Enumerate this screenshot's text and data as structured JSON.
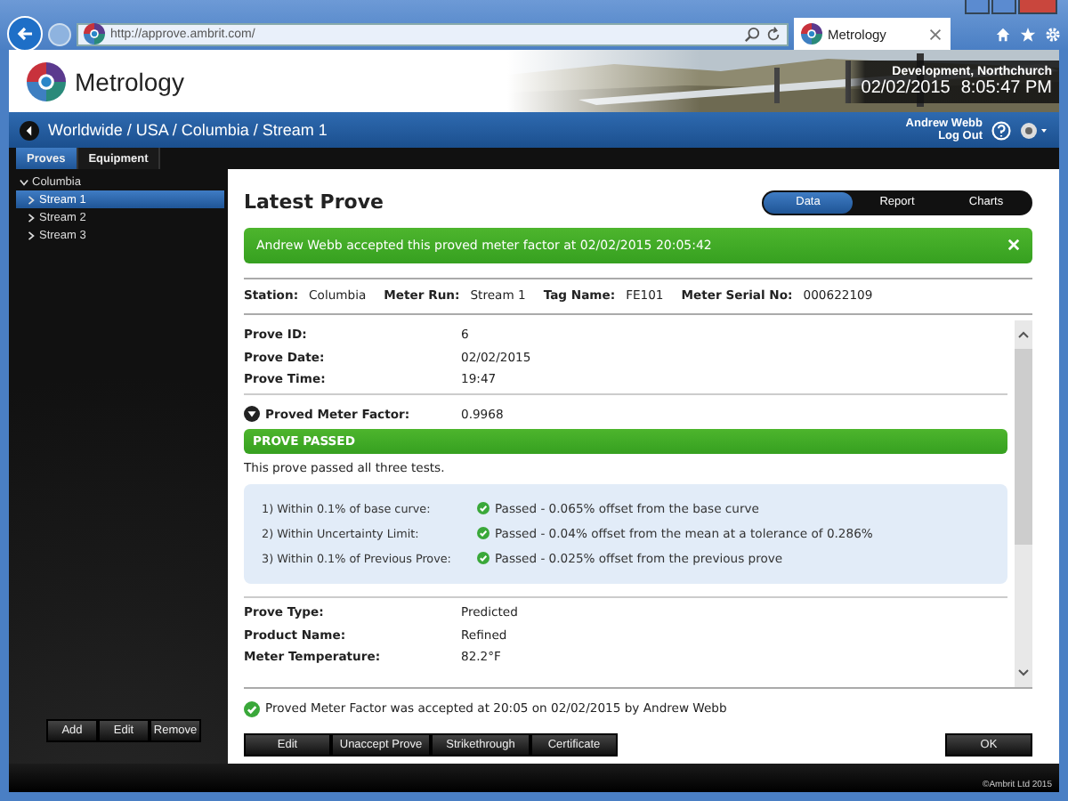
{
  "browser": {
    "address": "http://approve.ambrit.com/",
    "tab_title": "Metrology"
  },
  "header": {
    "app_name": "Metrology",
    "location": "Development, Northchurch",
    "date": "02/02/2015",
    "time": "8:05:47 PM"
  },
  "breadcrumb": "Worldwide / USA / Columbia / Stream 1",
  "user": {
    "name": "Andrew Webb",
    "logout": "Log Out"
  },
  "nav_tabs": [
    {
      "label": "Proves",
      "selected": true
    },
    {
      "label": "Equipment",
      "selected": false
    }
  ],
  "sidebar": {
    "tree": [
      {
        "label": "Columbia",
        "expanded": true,
        "selected": false,
        "children": [
          {
            "label": "Stream 1",
            "selected": true
          },
          {
            "label": "Stream 2",
            "selected": false
          },
          {
            "label": "Stream 3",
            "selected": false
          }
        ]
      }
    ],
    "buttons": [
      "Add",
      "Edit",
      "Remove"
    ]
  },
  "main": {
    "title": "Latest Prove",
    "view_tabs": [
      {
        "label": "Data",
        "selected": true
      },
      {
        "label": "Report",
        "selected": false
      },
      {
        "label": "Charts",
        "selected": false
      }
    ],
    "banner": "Andrew Webb accepted this proved meter factor at 02/02/2015 20:05:42",
    "summary": [
      {
        "label": "Station:",
        "value": "Columbia"
      },
      {
        "label": "Meter Run:",
        "value": "Stream 1"
      },
      {
        "label": "Tag Name:",
        "value": "FE101"
      },
      {
        "label": "Meter Serial No:",
        "value": "000622109"
      }
    ],
    "prove_fields": [
      {
        "label": "Prove ID:",
        "value": "6"
      },
      {
        "label": "Prove Date:",
        "value": "02/02/2015"
      },
      {
        "label": "Prove Time:",
        "value": "19:47"
      }
    ],
    "meter_factor": {
      "label": "Proved Meter Factor:",
      "value": "0.9968",
      "expanded": true
    },
    "result": {
      "status": "PROVE PASSED",
      "summary": "This prove passed all three tests."
    },
    "tests": [
      {
        "label": "1) Within 0.1% of base curve:",
        "result": "Passed - 0.065% offset from the base curve"
      },
      {
        "label": "2) Within Uncertainty Limit:",
        "result": "Passed - 0.04% offset from the mean at a tolerance of 0.286%"
      },
      {
        "label": "3) Within 0.1% of Previous Prove:",
        "result": "Passed - 0.025% offset from the previous prove"
      }
    ],
    "other_fields": [
      {
        "label": "Prove Type:",
        "value": "Predicted"
      },
      {
        "label": "Product Name:",
        "value": "Refined"
      },
      {
        "label": "Meter Temperature:",
        "value": "82.2°F"
      }
    ],
    "note": "Proved Meter Factor was accepted at 20:05 on 02/02/2015 by Andrew Webb",
    "actions": [
      "Edit",
      "Unaccept Prove",
      "Strikethrough",
      "Certificate"
    ],
    "ok": "OK"
  },
  "copyright": "©Ambrit Ltd 2015"
}
